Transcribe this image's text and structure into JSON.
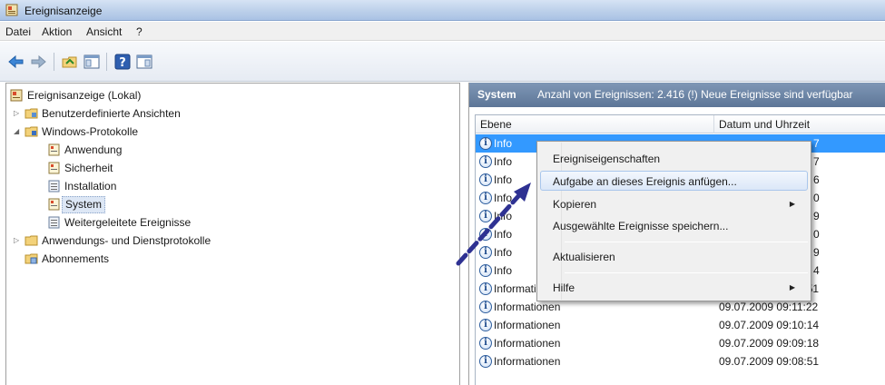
{
  "window": {
    "title": "Ereignisanzeige"
  },
  "menubar": {
    "items": [
      "Datei",
      "Aktion",
      "Ansicht",
      "?"
    ]
  },
  "toolbar": {
    "buttons": [
      "back-icon",
      "forward-icon",
      "up-folder-icon",
      "show-hide-tree-icon",
      "help-icon",
      "show-action-pane-icon"
    ]
  },
  "tree": {
    "root": "Ereignisanzeige (Lokal)",
    "items": [
      {
        "label": "Benutzerdefinierte Ansichten",
        "icon": "folder-icon"
      },
      {
        "label": "Windows-Protokolle",
        "icon": "folder-icon"
      },
      {
        "label": "Anwendung",
        "icon": "log-icon"
      },
      {
        "label": "Sicherheit",
        "icon": "log-icon"
      },
      {
        "label": "Installation",
        "icon": "log-icon"
      },
      {
        "label": "System",
        "icon": "log-icon"
      },
      {
        "label": "Weitergeleitete Ereignisse",
        "icon": "log-icon"
      },
      {
        "label": "Anwendungs- und Dienstprotokolle",
        "icon": "folder-icon"
      },
      {
        "label": "Abonnements",
        "icon": "subscription-icon"
      }
    ]
  },
  "details": {
    "title": "System",
    "info": "Anzahl von Ereignissen: 2.416 (!) Neue Ereignisse sind verfügbar",
    "columns": [
      "Ebene",
      "Datum und Uhrzeit"
    ],
    "rows": [
      {
        "level": "Informationen",
        "date": "09.07.2009 09:18:51"
      },
      {
        "level": "Informationen",
        "date": "09.07.2009 09:11:22"
      },
      {
        "level": "Informationen",
        "date": "09.07.2009 09:10:14"
      },
      {
        "level": "Informationen",
        "date": "09.07.2009 09:09:18"
      },
      {
        "level": "Informationen",
        "date": "09.07.2009 09:08:51"
      }
    ],
    "partial_rows": [
      {
        "level": "Info",
        "date_tail": "7"
      },
      {
        "level": "Info",
        "date_tail": "7"
      },
      {
        "level": "Info",
        "date_tail": "6"
      },
      {
        "level": "Info",
        "date_tail": "0"
      },
      {
        "level": "Info",
        "date_tail": "9"
      },
      {
        "level": "Info",
        "date_tail": "0"
      },
      {
        "level": "Info",
        "date_tail": "9"
      },
      {
        "level": "Info",
        "date_tail": "4"
      }
    ]
  },
  "context_menu": {
    "items": [
      "Ereigniseigenschaften",
      "Aufgabe an dieses Ereignis anfügen...",
      "Kopieren",
      "Ausgewählte Ereignisse speichern...",
      "Aktualisieren",
      "Hilfe"
    ],
    "highlighted_item": "Aufgabe an dieses Ereignis anfügen..."
  },
  "colors": {
    "selection": "#3399ff",
    "header_bar": "#6a83a4",
    "annotation_arrow": "#2e3192"
  }
}
